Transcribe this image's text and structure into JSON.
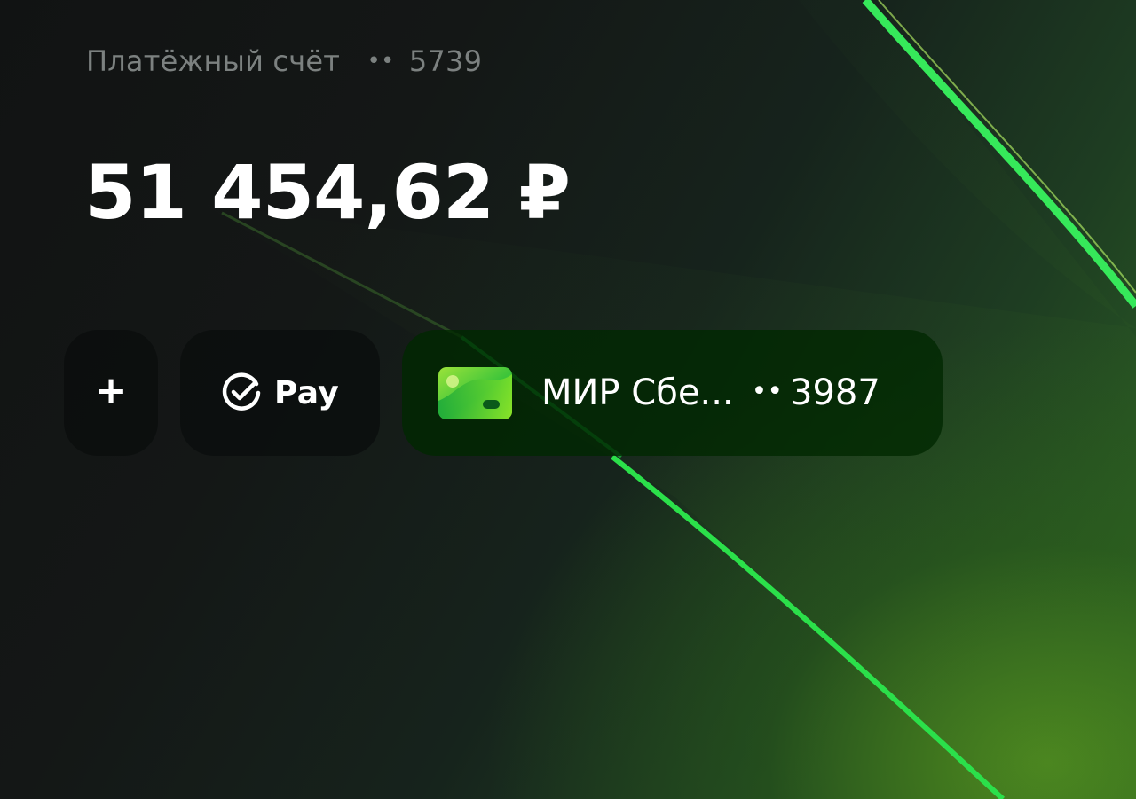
{
  "account": {
    "label": "Платёжный счёт",
    "mask": "••",
    "number": "5739"
  },
  "balance": {
    "amount": "51 454,62 ₽"
  },
  "actions": {
    "add_label": "+",
    "pay_label": "Pay"
  },
  "card": {
    "name": "МИР Сбе...",
    "mask": "••",
    "number": "3987"
  },
  "colors": {
    "accent_green": "#27d83f",
    "muted_text": "#7c8180",
    "text": "#ffffff"
  }
}
